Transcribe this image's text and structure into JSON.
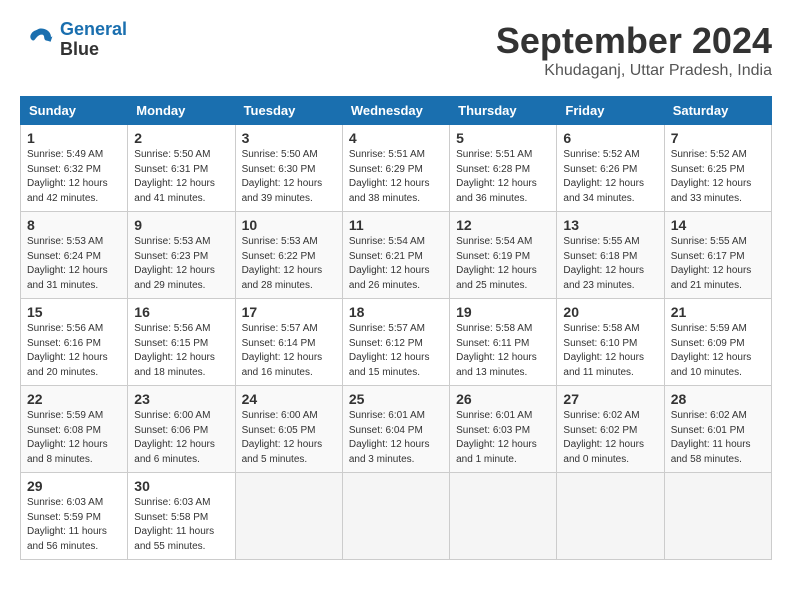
{
  "header": {
    "logo_line1": "General",
    "logo_line2": "Blue",
    "month": "September 2024",
    "location": "Khudaganj, Uttar Pradesh, India"
  },
  "columns": [
    "Sunday",
    "Monday",
    "Tuesday",
    "Wednesday",
    "Thursday",
    "Friday",
    "Saturday"
  ],
  "weeks": [
    [
      {
        "day": "1",
        "info": "Sunrise: 5:49 AM\nSunset: 6:32 PM\nDaylight: 12 hours\nand 42 minutes."
      },
      {
        "day": "2",
        "info": "Sunrise: 5:50 AM\nSunset: 6:31 PM\nDaylight: 12 hours\nand 41 minutes."
      },
      {
        "day": "3",
        "info": "Sunrise: 5:50 AM\nSunset: 6:30 PM\nDaylight: 12 hours\nand 39 minutes."
      },
      {
        "day": "4",
        "info": "Sunrise: 5:51 AM\nSunset: 6:29 PM\nDaylight: 12 hours\nand 38 minutes."
      },
      {
        "day": "5",
        "info": "Sunrise: 5:51 AM\nSunset: 6:28 PM\nDaylight: 12 hours\nand 36 minutes."
      },
      {
        "day": "6",
        "info": "Sunrise: 5:52 AM\nSunset: 6:26 PM\nDaylight: 12 hours\nand 34 minutes."
      },
      {
        "day": "7",
        "info": "Sunrise: 5:52 AM\nSunset: 6:25 PM\nDaylight: 12 hours\nand 33 minutes."
      }
    ],
    [
      {
        "day": "8",
        "info": "Sunrise: 5:53 AM\nSunset: 6:24 PM\nDaylight: 12 hours\nand 31 minutes."
      },
      {
        "day": "9",
        "info": "Sunrise: 5:53 AM\nSunset: 6:23 PM\nDaylight: 12 hours\nand 29 minutes."
      },
      {
        "day": "10",
        "info": "Sunrise: 5:53 AM\nSunset: 6:22 PM\nDaylight: 12 hours\nand 28 minutes."
      },
      {
        "day": "11",
        "info": "Sunrise: 5:54 AM\nSunset: 6:21 PM\nDaylight: 12 hours\nand 26 minutes."
      },
      {
        "day": "12",
        "info": "Sunrise: 5:54 AM\nSunset: 6:19 PM\nDaylight: 12 hours\nand 25 minutes."
      },
      {
        "day": "13",
        "info": "Sunrise: 5:55 AM\nSunset: 6:18 PM\nDaylight: 12 hours\nand 23 minutes."
      },
      {
        "day": "14",
        "info": "Sunrise: 5:55 AM\nSunset: 6:17 PM\nDaylight: 12 hours\nand 21 minutes."
      }
    ],
    [
      {
        "day": "15",
        "info": "Sunrise: 5:56 AM\nSunset: 6:16 PM\nDaylight: 12 hours\nand 20 minutes."
      },
      {
        "day": "16",
        "info": "Sunrise: 5:56 AM\nSunset: 6:15 PM\nDaylight: 12 hours\nand 18 minutes."
      },
      {
        "day": "17",
        "info": "Sunrise: 5:57 AM\nSunset: 6:14 PM\nDaylight: 12 hours\nand 16 minutes."
      },
      {
        "day": "18",
        "info": "Sunrise: 5:57 AM\nSunset: 6:12 PM\nDaylight: 12 hours\nand 15 minutes."
      },
      {
        "day": "19",
        "info": "Sunrise: 5:58 AM\nSunset: 6:11 PM\nDaylight: 12 hours\nand 13 minutes."
      },
      {
        "day": "20",
        "info": "Sunrise: 5:58 AM\nSunset: 6:10 PM\nDaylight: 12 hours\nand 11 minutes."
      },
      {
        "day": "21",
        "info": "Sunrise: 5:59 AM\nSunset: 6:09 PM\nDaylight: 12 hours\nand 10 minutes."
      }
    ],
    [
      {
        "day": "22",
        "info": "Sunrise: 5:59 AM\nSunset: 6:08 PM\nDaylight: 12 hours\nand 8 minutes."
      },
      {
        "day": "23",
        "info": "Sunrise: 6:00 AM\nSunset: 6:06 PM\nDaylight: 12 hours\nand 6 minutes."
      },
      {
        "day": "24",
        "info": "Sunrise: 6:00 AM\nSunset: 6:05 PM\nDaylight: 12 hours\nand 5 minutes."
      },
      {
        "day": "25",
        "info": "Sunrise: 6:01 AM\nSunset: 6:04 PM\nDaylight: 12 hours\nand 3 minutes."
      },
      {
        "day": "26",
        "info": "Sunrise: 6:01 AM\nSunset: 6:03 PM\nDaylight: 12 hours\nand 1 minute."
      },
      {
        "day": "27",
        "info": "Sunrise: 6:02 AM\nSunset: 6:02 PM\nDaylight: 12 hours\nand 0 minutes."
      },
      {
        "day": "28",
        "info": "Sunrise: 6:02 AM\nSunset: 6:01 PM\nDaylight: 11 hours\nand 58 minutes."
      }
    ],
    [
      {
        "day": "29",
        "info": "Sunrise: 6:03 AM\nSunset: 5:59 PM\nDaylight: 11 hours\nand 56 minutes."
      },
      {
        "day": "30",
        "info": "Sunrise: 6:03 AM\nSunset: 5:58 PM\nDaylight: 11 hours\nand 55 minutes."
      },
      {
        "day": "",
        "info": ""
      },
      {
        "day": "",
        "info": ""
      },
      {
        "day": "",
        "info": ""
      },
      {
        "day": "",
        "info": ""
      },
      {
        "day": "",
        "info": ""
      }
    ]
  ]
}
